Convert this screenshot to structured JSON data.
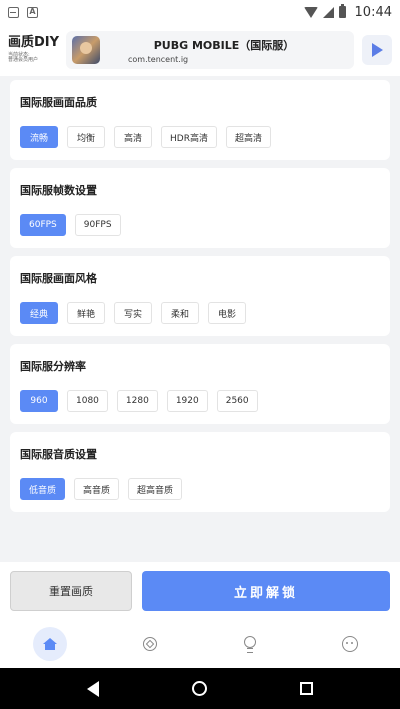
{
  "status_bar": {
    "time": "10:44",
    "icons": [
      "mail-icon",
      "text-a-icon",
      "wifi-icon",
      "signal-icon",
      "battery-icon"
    ]
  },
  "header": {
    "brand_logo": "画质DIY",
    "brand_sub": "当前状态:\n普通会员用户",
    "game_title": "PUBG MOBILE（国际服）",
    "game_package": "com.tencent.ig",
    "play_icon": "play-icon"
  },
  "sections": [
    {
      "title": "国际服画面品质",
      "options": [
        "流畅",
        "均衡",
        "高清",
        "HDR高清",
        "超高清"
      ],
      "selected": "流畅"
    },
    {
      "title": "国际服帧数设置",
      "options": [
        "60FPS",
        "90FPS"
      ],
      "selected": "60FPS"
    },
    {
      "title": "国际服画面风格",
      "options": [
        "经典",
        "鲜艳",
        "写实",
        "柔和",
        "电影"
      ],
      "selected": "经典"
    },
    {
      "title": "国际服分辨率",
      "options": [
        "960",
        "1080",
        "1280",
        "1920",
        "2560"
      ],
      "selected": "960"
    },
    {
      "title": "国际服音质设置",
      "options": [
        "低音质",
        "高音质",
        "超高音质"
      ],
      "selected": "低音质"
    }
  ],
  "actions": {
    "reset_label": "重置画质",
    "unlock_label": "立即解锁"
  },
  "tabbar": {
    "tabs": [
      "home-icon",
      "compass-icon",
      "lightbulb-icon",
      "more-icon"
    ],
    "active": "home-icon"
  },
  "colors": {
    "accent": "#5b8af5",
    "background": "#f2f3f5",
    "card": "#ffffff"
  }
}
